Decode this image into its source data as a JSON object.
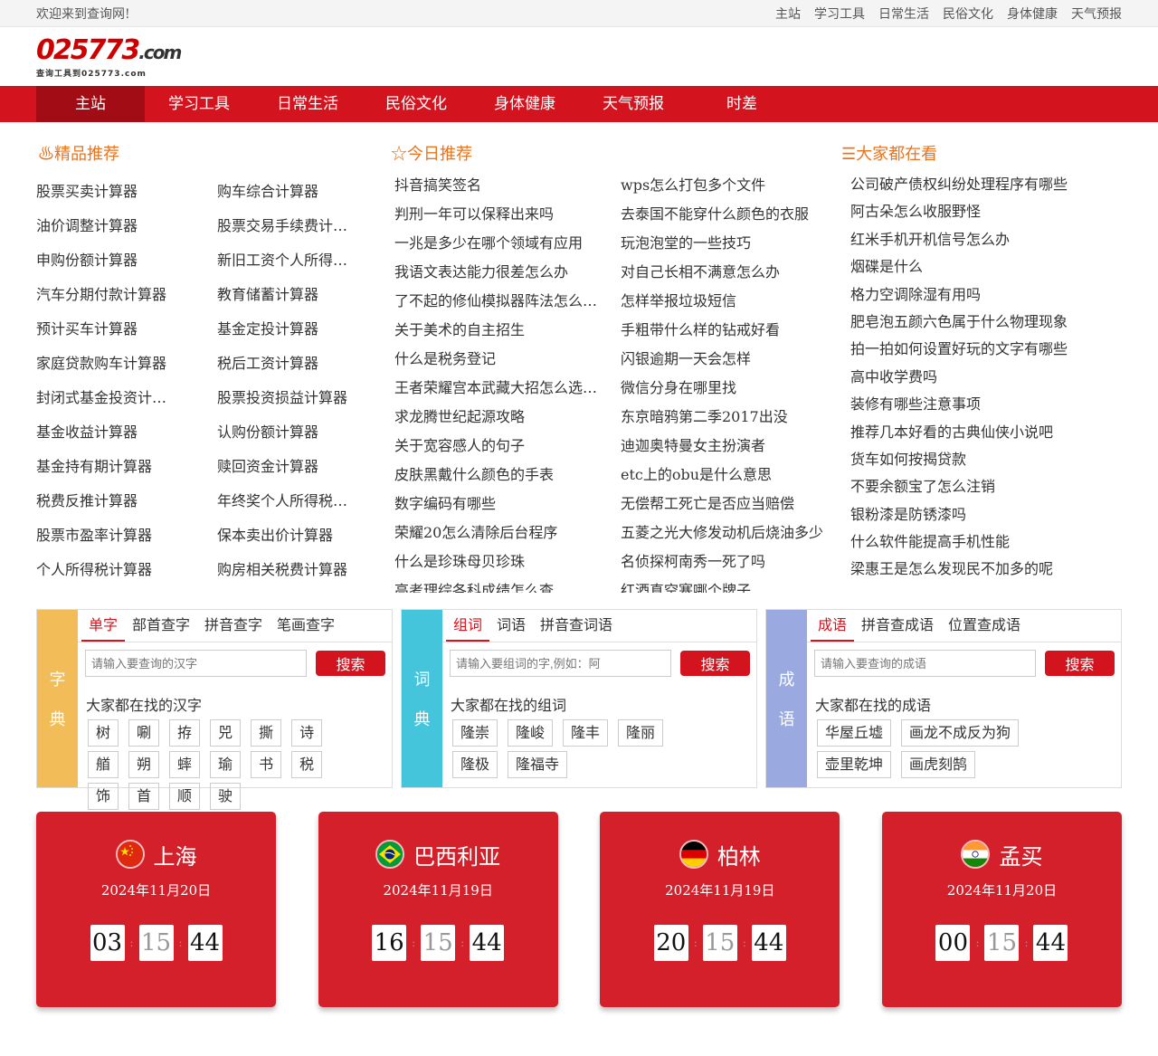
{
  "topbar": {
    "welcome": "欢迎来到查询网!",
    "links": [
      "主站",
      "学习工具",
      "日常生活",
      "民俗文化",
      "身体健康",
      "天气预报"
    ]
  },
  "logo": {
    "main": "025773",
    "suffix": ".com",
    "sub": "查询工具到025773.com"
  },
  "nav": [
    "主站",
    "学习工具",
    "日常生活",
    "民俗文化",
    "身体健康",
    "天气预报",
    "时差"
  ],
  "featured": {
    "title": "精品推荐",
    "items": [
      "股票买卖计算器",
      "购车综合计算器",
      "油价调整计算器",
      "股票交易手续费计算器",
      "申购份额计算器",
      "新旧工资个人所得税计算器",
      "汽车分期付款计算器",
      "教育储蓄计算器",
      "预计买车计算器",
      "基金定投计算器",
      "家庭贷款购车计算器",
      "税后工资计算器",
      "封闭式基金投资计算器",
      "股票投资损益计算器",
      "基金收益计算器",
      "认购份额计算器",
      "基金持有期计算器",
      "赎回资金计算器",
      "税费反推计算器",
      "年终奖个人所得税计算器",
      "股票市盈率计算器",
      "保本卖出价计算器",
      "个人所得税计算器",
      "购房相关税费计算器"
    ]
  },
  "today": {
    "title": "今日推荐",
    "items": [
      "抖音搞笑签名",
      "wps怎么打包多个文件",
      "判刑一年可以保释出来吗",
      "去泰国不能穿什么颜色的衣服",
      "一兆是多少在哪个领域有应用",
      "玩泡泡堂的一些技巧",
      "我语文表达能力很差怎么办",
      "对自己长相不满意怎么办",
      "了不起的修仙模拟器阵法怎么布置",
      "怎样举报垃圾短信",
      "关于美术的自主招生",
      "手粗带什么样的钻戒好看",
      "什么是税务登记",
      "闪银逾期一天会怎样",
      "王者荣耀宫本武藏大招怎么选目标",
      "微信分身在哪里找",
      "求龙腾世纪起源攻略",
      "东京暗鸦第二季2017出没",
      "关于宽容感人的句子",
      "迪迦奥特曼女主扮演者",
      "皮肤黑戴什么颜色的手表",
      "etc上的obu是什么意思",
      "数字编码有哪些",
      "无偿帮工死亡是否应当赔偿",
      "荣耀20怎么清除后台程序",
      "五菱之光大修发动机后烧油多少",
      "什么是珍珠母贝珍珠",
      "名侦探柯南秀一死了吗",
      "高考理综各科成绩怎么查",
      "红酒真空塞哪个牌子"
    ]
  },
  "watching": {
    "title": "大家都在看",
    "items": [
      "公司破产债权纠纷处理程序有哪些",
      "阿古朵怎么收服野怪",
      "红米手机开机信号怎么办",
      "烟碟是什么",
      "格力空调除湿有用吗",
      "肥皂泡五颜六色属于什么物理现象",
      "拍一拍如何设置好玩的文字有哪些",
      "高中收学费吗",
      "装修有哪些注意事项",
      "推荐几本好看的古典仙侠小说吧",
      "货车如何按揭贷款",
      "不要余额宝了怎么注销",
      "银粉漆是防锈漆吗",
      "什么软件能提高手机性能",
      "梁惠王是怎么发现民不加多的呢"
    ]
  },
  "dicts": [
    {
      "side": [
        "字",
        "典"
      ],
      "color": "#f2bd59",
      "tabs": [
        "单字",
        "部首查字",
        "拼音查字",
        "笔画查字"
      ],
      "placeholder": "请输入要查询的汉字",
      "button": "搜索",
      "hot_label": "大家都在找的汉字",
      "tags": [
        "树",
        "唰",
        "拵",
        "兕",
        "撕",
        "诗",
        "艏",
        "朔",
        "蟀",
        "瑜",
        "书",
        "税",
        "饰",
        "首",
        "顺",
        "驶"
      ]
    },
    {
      "side": [
        "词",
        "典"
      ],
      "color": "#45c5dc",
      "tabs": [
        "组词",
        "词语",
        "拼音查词语"
      ],
      "placeholder": "请输入要组词的字,例如：阿",
      "button": "搜索",
      "hot_label": "大家都在找的组词",
      "tags": [
        "隆崇",
        "隆峻",
        "隆丰",
        "隆丽",
        "隆极",
        "隆福寺"
      ]
    },
    {
      "side": [
        "成",
        "语"
      ],
      "color": "#9aaae0",
      "tabs": [
        "成语",
        "拼音查成语",
        "位置查成语"
      ],
      "placeholder": "请输入要查询的成语",
      "button": "搜索",
      "hot_label": "大家都在找的成语",
      "tags": [
        "华屋丘墟",
        "画龙不成反为狗",
        "壶里乾坤",
        "画虎刻鹄"
      ]
    }
  ],
  "clocks": [
    {
      "city": "上海",
      "date": "2024年11月20日",
      "h": "03",
      "m": "15",
      "s": "44",
      "flag": "china-flag-icon"
    },
    {
      "city": "巴西利亚",
      "date": "2024年11月19日",
      "h": "16",
      "m": "15",
      "s": "44",
      "flag": "brazil-flag-icon"
    },
    {
      "city": "柏林",
      "date": "2024年11月19日",
      "h": "20",
      "m": "15",
      "s": "44",
      "flag": "germany-flag-icon"
    },
    {
      "city": "孟买",
      "date": "2024年11月20日",
      "h": "00",
      "m": "15",
      "s": "44",
      "flag": "india-flag-icon"
    }
  ],
  "colors": {
    "brand_red": "#d3141f",
    "title_orange": "#e8741f",
    "clock_red": "#d3202a"
  },
  "icons": {
    "featured": "fire-icon",
    "today": "star-icon",
    "watching": "eye-icon"
  }
}
